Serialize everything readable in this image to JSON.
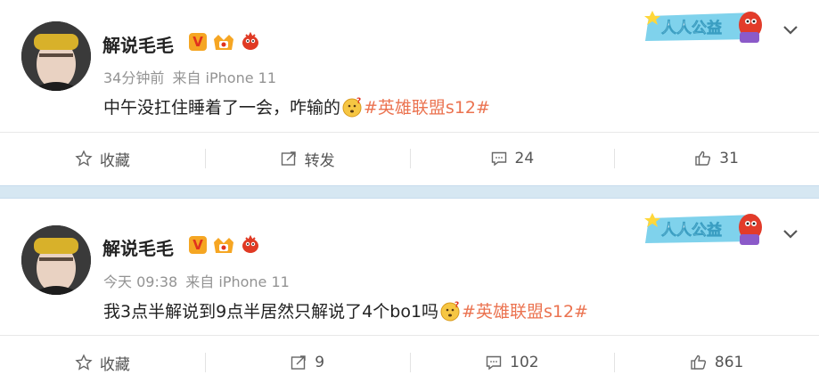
{
  "posts": [
    {
      "username": "解说毛毛",
      "time": "34分钟前",
      "source": "来自 iPhone 11",
      "text": "中午没扛住睡着了一会，咋输的",
      "hashtag": "#英雄联盟s12#",
      "badge_label": "人人公益",
      "actions": {
        "favorite": "收藏",
        "repost": "转发",
        "comments": "24",
        "likes": "31"
      }
    },
    {
      "username": "解说毛毛",
      "time": "今天 09:38",
      "source": "来自 iPhone 11",
      "text": "我3点半解说到9点半居然只解说了4个bo1吗",
      "hashtag": "#英雄联盟s12#",
      "badge_label": "人人公益",
      "actions": {
        "favorite": "收藏",
        "repost": "9",
        "comments": "102",
        "likes": "861"
      }
    }
  ],
  "icons": {
    "verified": "verified-v-badge-icon",
    "crown": "crown-badge-icon",
    "mascot": "red-fish-mascot-icon",
    "emoji": "thinking-question-emoji-icon",
    "chevron": "chevron-down-icon",
    "star": "star-icon",
    "repost": "repost-icon",
    "comment": "comment-icon",
    "like": "thumbs-up-icon"
  },
  "colors": {
    "hashtag": "#eb7350",
    "separator": "#d6e7f2",
    "gongyi": "#7fd2ec"
  }
}
